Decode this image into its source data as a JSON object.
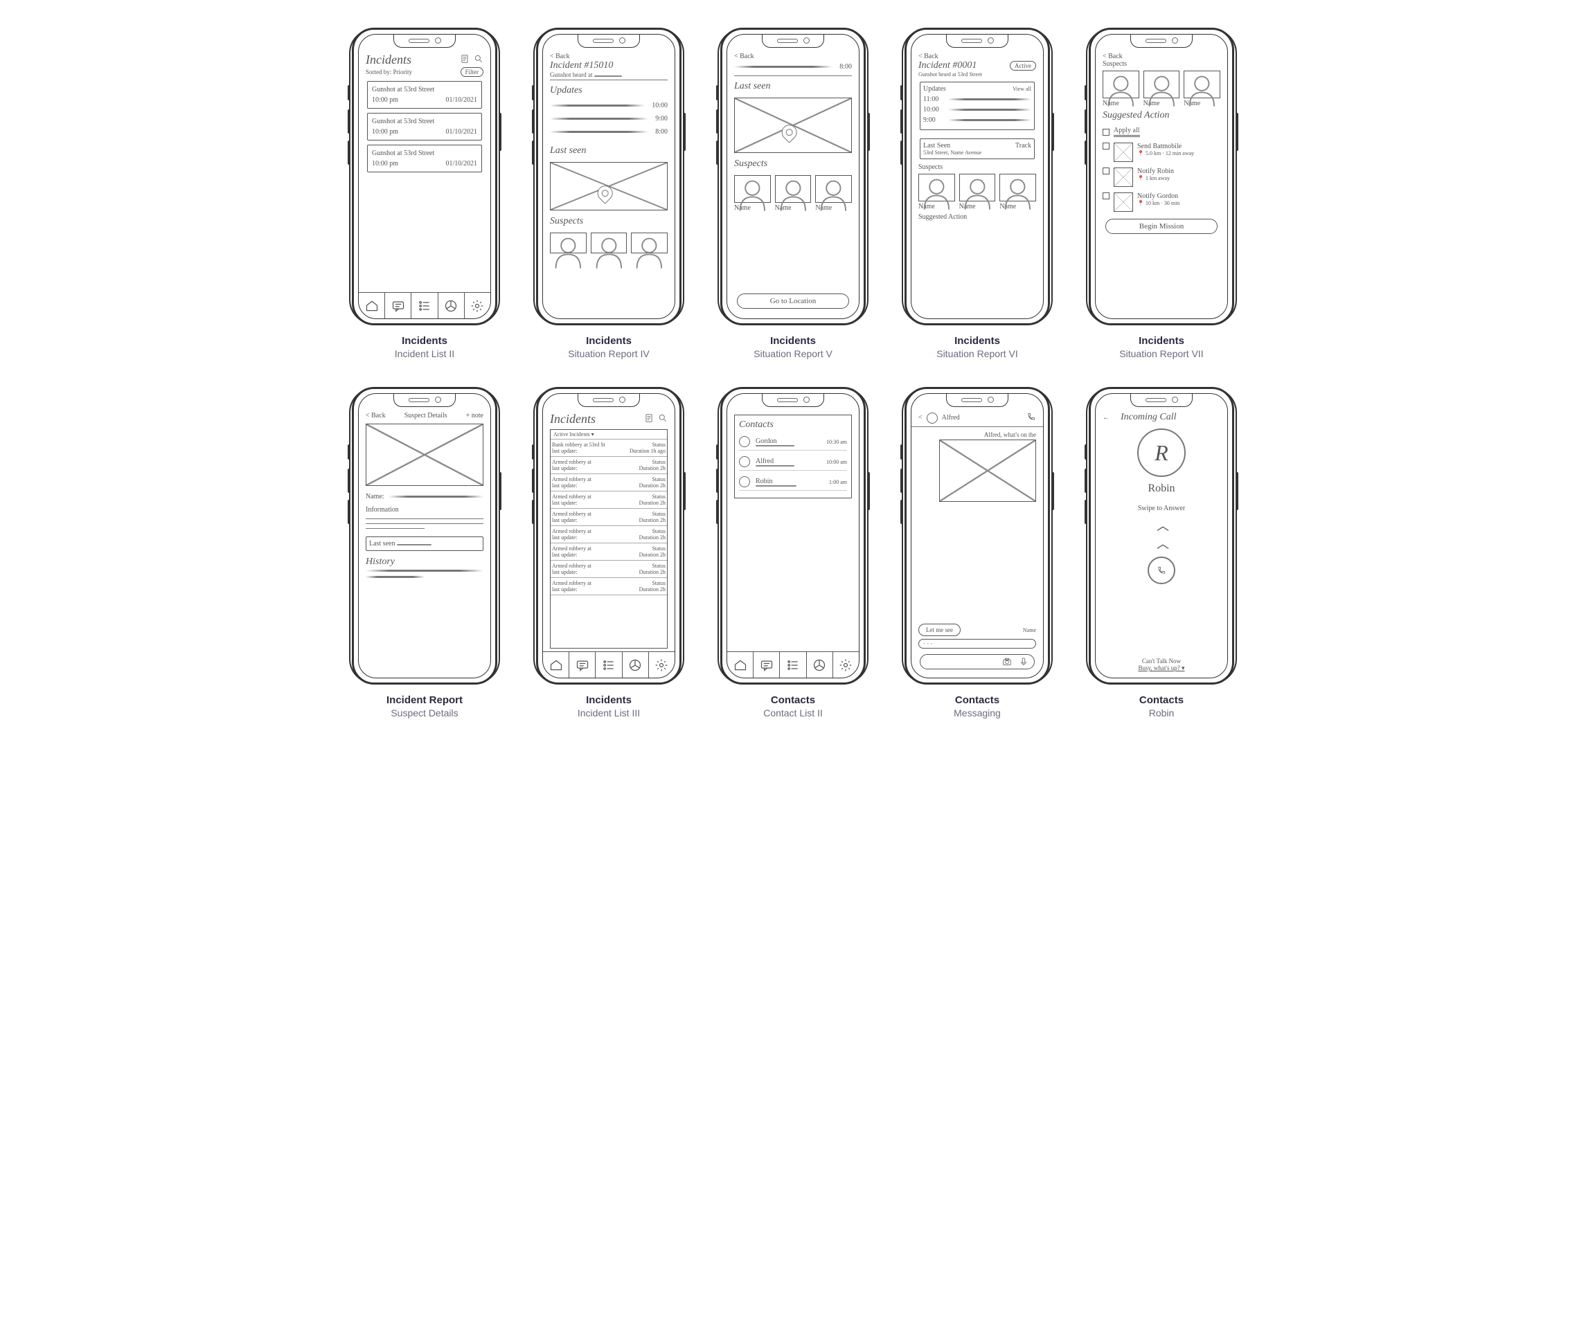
{
  "wireframes": [
    {
      "group": "Incidents",
      "name": "Incident List II",
      "header": {
        "title": "Incidents",
        "sort": "Sorted by: Priority",
        "filter": "Filter"
      },
      "cards": [
        {
          "title": "Gunshot at 53rd Street",
          "time": "10:00 pm",
          "date": "01/10/2021"
        },
        {
          "title": "Gunshot at 53rd Street",
          "time": "10:00 pm",
          "date": "01/10/2021"
        },
        {
          "title": "Gunshot at 53rd Street",
          "time": "10:00 pm",
          "date": "01/10/2021"
        }
      ]
    },
    {
      "group": "Incidents",
      "name": "Situation Report IV",
      "back": "< Back",
      "header": {
        "title": "Incident #15010",
        "sub": "Gunshot heard at"
      },
      "updates": {
        "label": "Updates",
        "items": [
          {
            "time": "10:00"
          },
          {
            "time": "9:00"
          },
          {
            "time": "8:00"
          }
        ]
      },
      "lastseen": "Last seen",
      "suspects": "Suspects"
    },
    {
      "group": "Incidents",
      "name": "Situation Report V",
      "back": "< Back",
      "topTime": "8:00",
      "lastseen": "Last seen",
      "suspects_label": "Suspects",
      "suspects": [
        {
          "name": "Name"
        },
        {
          "name": "Name"
        },
        {
          "name": "Name"
        }
      ],
      "cta": "Go to Location"
    },
    {
      "group": "Incidents",
      "name": "Situation Report VI",
      "back": "< Back",
      "header": {
        "title": "Incident #0001",
        "status": "Active",
        "sub": "Gunshot heard at 53rd Street"
      },
      "updates": {
        "label": "Updates",
        "viewall": "View all",
        "items": [
          {
            "time": "11:00"
          },
          {
            "time": "10:00"
          },
          {
            "time": "9:00"
          }
        ]
      },
      "lastseen": {
        "label": "Last Seen",
        "track": "Track",
        "loc": "53rd Street, Name Avenue"
      },
      "suspects_label": "Suspects",
      "suspects": [
        {
          "name": "Name"
        },
        {
          "name": "Name"
        },
        {
          "name": "Name"
        }
      ],
      "suggested": "Suggested Action"
    },
    {
      "group": "Incidents",
      "name": "Situation Report VII",
      "back": "< Back",
      "suspects_label": "Suspects",
      "suspects": [
        {
          "name": "Name"
        },
        {
          "name": "Name"
        },
        {
          "name": "Name"
        }
      ],
      "suggested_label": "Suggested Action",
      "apply_all": "Apply all",
      "actions": [
        {
          "title": "Send Batmobile",
          "meta": "5.0 km · 12 min away"
        },
        {
          "title": "Notify Robin",
          "meta": "1 km away"
        },
        {
          "title": "Notify Gordon",
          "meta": "10 km · 30 min"
        }
      ],
      "cta": "Begin Mission"
    },
    {
      "group": "Incident Report",
      "name": "Suspect Details",
      "back": "< Back",
      "title": "Suspect Details",
      "add": "+ note",
      "name_label": "Name:",
      "info_label": "Information",
      "lastseen": "Last seen",
      "history": "History"
    },
    {
      "group": "Incidents",
      "name": "Incident List III",
      "title": "Incidents",
      "subhead": "Active Incidents ▾",
      "rows": [
        {
          "l1": "Bank robbery at 53rd St",
          "l2": "last update:",
          "r1": "Status",
          "r2": "Duration 1h ago"
        },
        {
          "l1": "Armed robbery at",
          "l2": "last update:",
          "r1": "Status",
          "r2": "Duration 2h"
        },
        {
          "l1": "Armed robbery at",
          "l2": "last update:",
          "r1": "Status",
          "r2": "Duration 2h"
        },
        {
          "l1": "Armed robbery at",
          "l2": "last update:",
          "r1": "Status",
          "r2": "Duration 2h"
        },
        {
          "l1": "Armed robbery at",
          "l2": "last update:",
          "r1": "Status",
          "r2": "Duration 2h"
        },
        {
          "l1": "Armed robbery at",
          "l2": "last update:",
          "r1": "Status",
          "r2": "Duration 2h"
        },
        {
          "l1": "Armed robbery at",
          "l2": "last update:",
          "r1": "Status",
          "r2": "Duration 2h"
        },
        {
          "l1": "Armed robbery at",
          "l2": "last update:",
          "r1": "Status",
          "r2": "Duration 2h"
        },
        {
          "l1": "Armed robbery at",
          "l2": "last update:",
          "r1": "Status",
          "r2": "Duration 2h"
        }
      ]
    },
    {
      "group": "Contacts",
      "name": "Contact List II",
      "title": "Contacts",
      "contacts": [
        {
          "name": "Gordon",
          "time": "10:30 am"
        },
        {
          "name": "Alfred",
          "time": "10:00 am"
        },
        {
          "name": "Robin",
          "time": "1:00 am"
        }
      ]
    },
    {
      "group": "Contacts",
      "name": "Messaging",
      "back": "<",
      "contact": "Alfred",
      "incoming": "Alfred, what's on the",
      "outgoing": "Let me see",
      "sender": "Name",
      "typing": "· · ·"
    },
    {
      "group": "Contacts",
      "name": "Robin",
      "back": "←",
      "title": "Incoming Call",
      "initial": "R",
      "swipe": "Swipe to Answer",
      "cant": "Can't Talk Now",
      "reply": "Busy, what's up? ▾"
    }
  ]
}
